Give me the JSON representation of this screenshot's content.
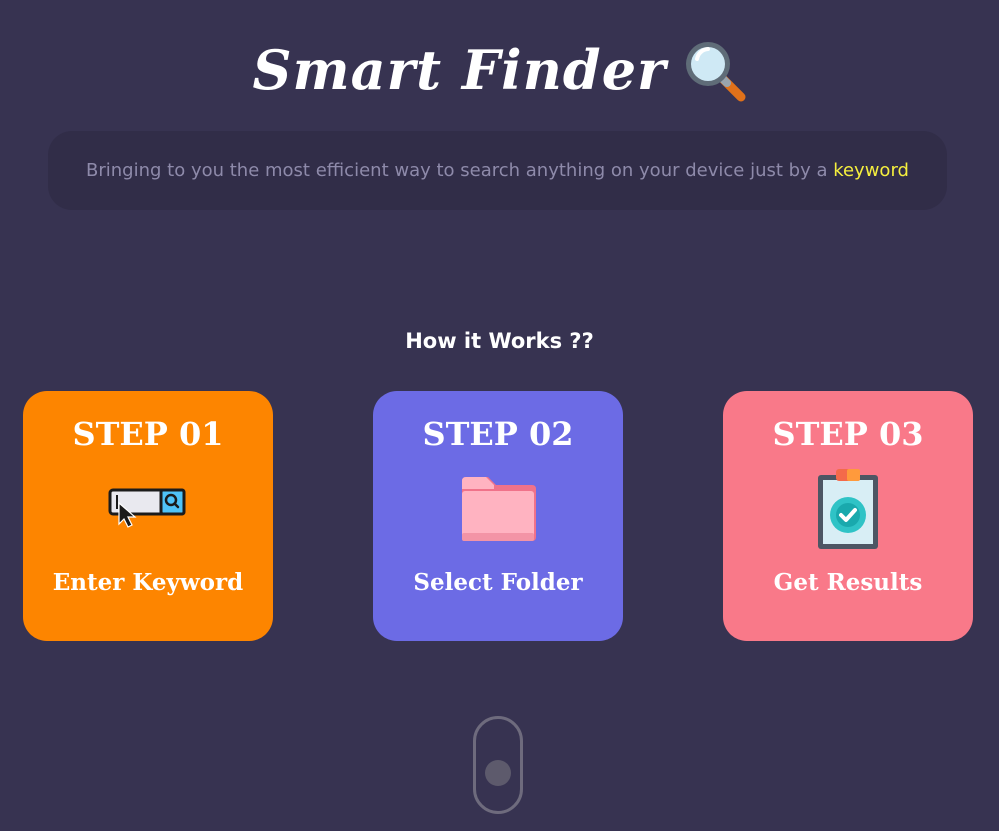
{
  "header": {
    "title": "Smart Finder",
    "title_icon": "magnifying-glass-icon"
  },
  "tagline": {
    "text_before": "Bringing to you the most efficient way to search anything on your device just by a ",
    "highlight": "keyword"
  },
  "how_it_works": {
    "heading": "How it Works ??"
  },
  "steps": [
    {
      "step": "STEP 01",
      "label": "Enter Keyword",
      "icon": "search-bar-cursor-icon",
      "color": "#fd8500"
    },
    {
      "step": "STEP 02",
      "label": "Select Folder",
      "icon": "folder-icon",
      "color": "#6c6be5"
    },
    {
      "step": "STEP 03",
      "label": "Get Results",
      "icon": "clipboard-check-icon",
      "color": "#f97989"
    }
  ],
  "colors": {
    "background": "#373351",
    "tagline_box": "#312d48",
    "highlight": "#f5ef3e"
  },
  "scroll_indicator": {
    "icon": "mouse-scroll-icon"
  }
}
